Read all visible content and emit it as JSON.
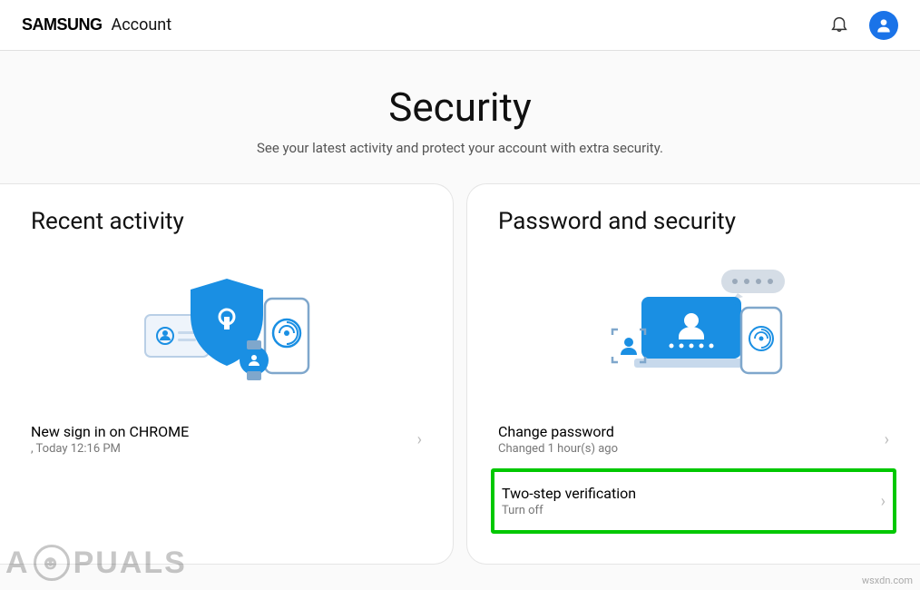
{
  "header": {
    "brand_primary": "SAMSUNG",
    "brand_secondary": "Account"
  },
  "page": {
    "title": "Security",
    "subtitle": "See your latest activity and protect your account with extra security."
  },
  "recent_activity": {
    "title": "Recent activity",
    "items": [
      {
        "title": "New sign in on CHROME",
        "sub": ", Today 12:16 PM"
      }
    ]
  },
  "password_security": {
    "title": "Password and security",
    "items": [
      {
        "title": "Change password",
        "sub": "Changed 1 hour(s) ago"
      },
      {
        "title": "Two-step verification",
        "sub": "Turn off"
      }
    ]
  },
  "watermarks": {
    "left_pre": "A",
    "left_post": "PUALS",
    "right": "wsxdn.com"
  }
}
